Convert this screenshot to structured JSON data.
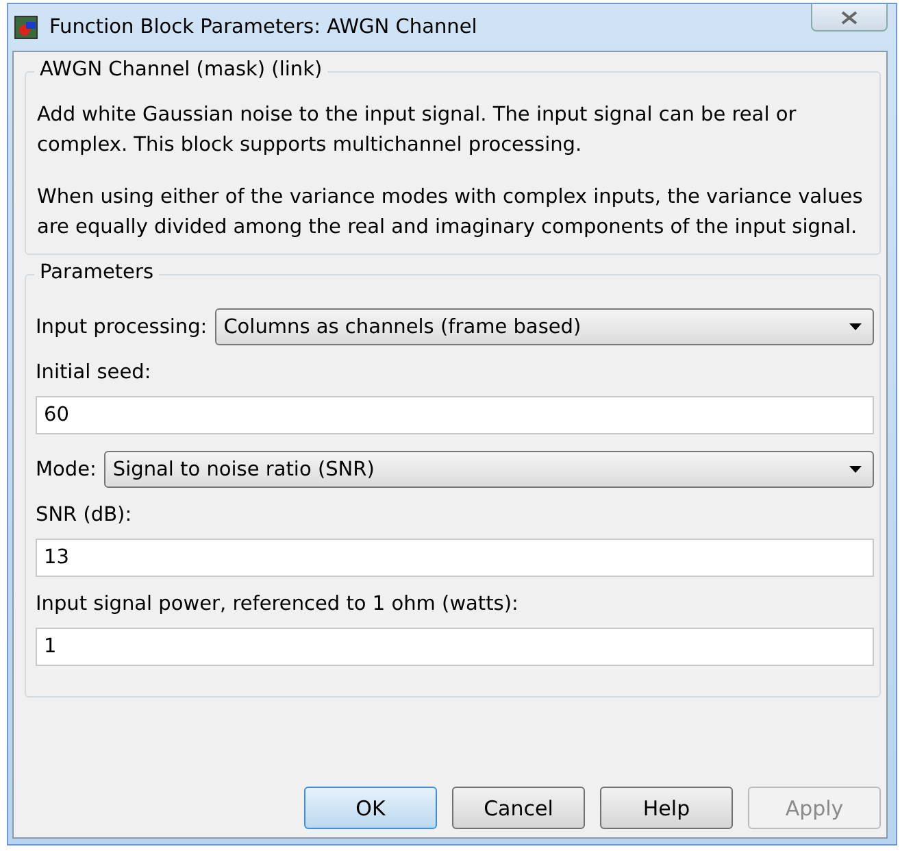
{
  "window": {
    "title": "Function Block Parameters: AWGN Channel"
  },
  "description": {
    "title": "AWGN Channel (mask) (link)",
    "paragraphs": [
      "Add white Gaussian noise to the input signal. The input signal can be real or complex. This block supports multichannel processing.",
      "When using either of the variance modes with complex inputs, the variance values are equally divided among the real and imaginary components of the input signal."
    ]
  },
  "parameters": {
    "title": "Parameters",
    "fields": [
      {
        "kind": "select",
        "label": "Input processing:",
        "value": "Columns as channels (frame based)"
      },
      {
        "kind": "text",
        "label": "Initial seed:",
        "value": "60"
      },
      {
        "kind": "select",
        "label": "Mode:",
        "value": "Signal to noise ratio  (SNR)"
      },
      {
        "kind": "text",
        "label": "SNR (dB):",
        "value": "13"
      },
      {
        "kind": "text",
        "label": "Input signal power, referenced to 1 ohm (watts):",
        "value": "1"
      }
    ]
  },
  "buttons": [
    {
      "label": "OK",
      "default": true,
      "disabled": false
    },
    {
      "label": "Cancel",
      "default": false,
      "disabled": false
    },
    {
      "label": "Help",
      "default": false,
      "disabled": false
    },
    {
      "label": "Apply",
      "default": false,
      "disabled": true
    }
  ]
}
